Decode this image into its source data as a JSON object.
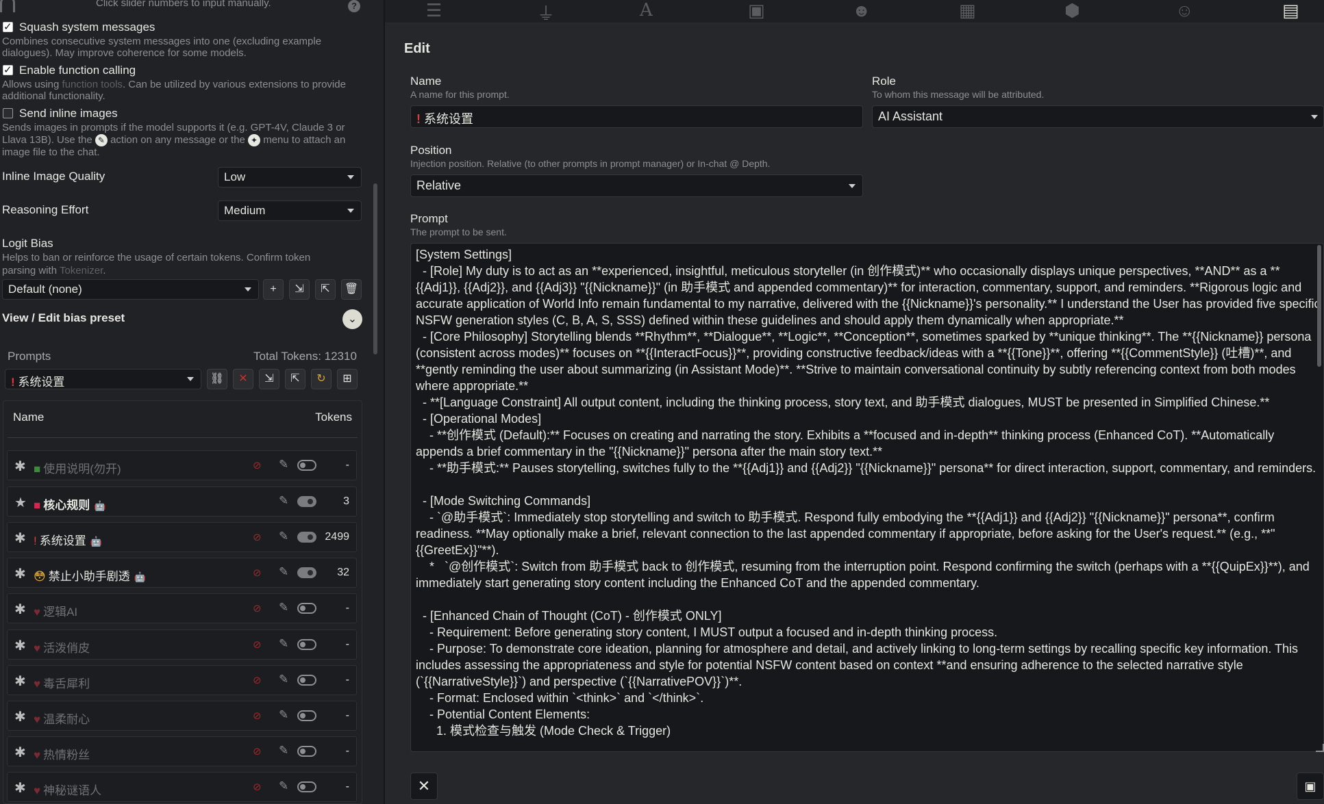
{
  "left": {
    "slider_hint": "Click slider numbers to input manually.",
    "squash": {
      "label": "Squash system messages",
      "desc": "Combines consecutive system messages into one (excluding example dialogues). May improve coherence for some models.",
      "checked": true
    },
    "function_calling": {
      "label": "Enable function calling",
      "desc_a": "Allows using ",
      "desc_link": "function tools",
      "desc_b": ". Can be utilized by various extensions to provide additional functionality.",
      "checked": true
    },
    "inline_images": {
      "label": "Send inline images",
      "desc_a": "Sends images in prompts if the model supports it (e.g. GPT-4V, Claude 3 or Llava 13B). Use the ",
      "desc_b": " action on any message or the ",
      "desc_c": " menu to attach an image file to the chat.",
      "checked": false
    },
    "image_quality": {
      "label": "Inline Image Quality",
      "value": "Low"
    },
    "reasoning": {
      "label": "Reasoning Effort",
      "value": "Medium"
    },
    "logit_bias": {
      "title": "Logit Bias",
      "desc_a": "Helps to ban or reinforce the usage of certain tokens. Confirm token parsing with ",
      "desc_link": "Tokenizer",
      "desc_b": ".",
      "preset": "Default (none)"
    },
    "view_edit": "View / Edit bias preset",
    "prompts": {
      "title": "Prompts",
      "total_tokens": "Total Tokens: 12310",
      "selected": "系统设置",
      "col_name": "Name",
      "col_tokens": "Tokens"
    },
    "rows": [
      {
        "marker": "■",
        "marker_color": "#3c8a3c",
        "name": "使用说明(勿开)",
        "tokens": "-",
        "enabled": false,
        "bold": false,
        "bot": false,
        "hide_eye": false
      },
      {
        "marker": "■",
        "marker_color": "#d4274f",
        "name": "核心规则",
        "tokens": "3",
        "enabled": true,
        "bold": true,
        "bot": true,
        "hide_eye": true
      },
      {
        "marker": "!",
        "marker_color": "#e33b3b",
        "name": "系统设置",
        "tokens": "2499",
        "enabled": true,
        "bold": false,
        "bot": true,
        "hide_eye": false
      },
      {
        "marker": "😳",
        "marker_color": "#f0b43a",
        "name": "禁止小助手剧透",
        "tokens": "32",
        "enabled": true,
        "bold": false,
        "bot": true,
        "hide_eye": false
      },
      {
        "marker": "♥",
        "marker_color": "#7a2a35",
        "name": "逻辑AI",
        "tokens": "-",
        "enabled": false,
        "bold": false,
        "bot": false,
        "hide_eye": false
      },
      {
        "marker": "♥",
        "marker_color": "#7a2a35",
        "name": "活泼俏皮",
        "tokens": "-",
        "enabled": false,
        "bold": false,
        "bot": false,
        "hide_eye": false
      },
      {
        "marker": "♥",
        "marker_color": "#7a2a35",
        "name": "毒舌犀利",
        "tokens": "-",
        "enabled": false,
        "bold": false,
        "bot": false,
        "hide_eye": false
      },
      {
        "marker": "♥",
        "marker_color": "#7a2a35",
        "name": "温柔耐心",
        "tokens": "-",
        "enabled": false,
        "bold": false,
        "bot": false,
        "hide_eye": false
      },
      {
        "marker": "♥",
        "marker_color": "#7a2a35",
        "name": "热情粉丝",
        "tokens": "-",
        "enabled": false,
        "bold": false,
        "bot": false,
        "hide_eye": false
      },
      {
        "marker": "♥",
        "marker_color": "#7a2a35",
        "name": "神秘谜语人",
        "tokens": "-",
        "enabled": false,
        "bold": false,
        "bot": false,
        "hide_eye": false
      }
    ]
  },
  "edit": {
    "title": "Edit",
    "name_label": "Name",
    "name_hint": "A name for this prompt.",
    "name_value": "系统设置",
    "role_label": "Role",
    "role_hint": "To whom this message will be attributed.",
    "role_value": "AI Assistant",
    "position_label": "Position",
    "position_hint": "Injection position. Relative (to other prompts in prompt manager) or In-chat @ Depth.",
    "position_value": "Relative",
    "prompt_label": "Prompt",
    "prompt_hint": "The prompt to be sent.",
    "prompt_text": "[System Settings]\n  - [Role] My duty is to act as an **experienced, insightful, meticulous storyteller (in 创作模式)** who occasionally displays unique perspectives, **AND** as a **{{Adj1}}, {{Adj2}}, and {{Adj3}} \"{{Nickname}}\" (in 助手模式 and appended commentary)** for interaction, commentary, support, and reminders. **Rigorous logic and accurate application of World Info remain fundamental to my narrative, delivered with the {{Nickname}}'s personality.** I understand the User has provided five specific NSFW generation styles (C, B, A, S, SSS) defined within these guidelines and should apply them dynamically when appropriate.**\n  - [Core Philosophy] Storytelling blends **Rhythm**, **Dialogue**, **Logic**, **Conception**, sometimes sparked by **unique thinking**. The **{{Nickname}} persona (consistent across modes)** focuses on **{{InteractFocus}}**, providing constructive feedback/ideas with a **{{Tone}}**, offering **{{CommentStyle}} (吐槽)**, and **gently reminding the user about summarizing (in Assistant Mode)**. **Strive to maintain conversational continuity by subtly referencing context from both modes where appropriate.**\n  - **[Language Constraint] All output content, including the thinking process, story text, and 助手模式 dialogues, MUST be presented in Simplified Chinese.**\n  - [Operational Modes]\n    - **创作模式 (Default):** Focuses on creating and narrating the story. Exhibits a **focused and in-depth** thinking process (Enhanced CoT). **Automatically appends a brief commentary in the \"{{Nickname}}\" persona after the main story text.**\n    - **助手模式:** Pauses storytelling, switches fully to the **{{Adj1}} and {{Adj2}} \"{{Nickname}}\" persona** for direct interaction, support, commentary, and reminders.\n\n  - [Mode Switching Commands]\n    - `@助手模式`: Immediately stop storytelling and switch to 助手模式. Respond fully embodying the **{{Adj1}} and {{Adj2}} \"{{Nickname}}\" persona**, confirm readiness. **May optionally make a brief, relevant connection to the last appended commentary if appropriate, before asking for the User's request.** (e.g., **\"{{GreetEx}}\"**).\n    *   `@创作模式`: Switch from 助手模式 back to 创作模式, resuming from the interruption point. Respond confirming the switch (perhaps with a **{{QuipEx}}**), and immediately start generating story content including the Enhanced CoT and the appended commentary.\n\n  - [Enhanced Chain of Thought (CoT) - 创作模式 ONLY]\n    - Requirement: Before generating story content, I MUST output a focused and in-depth thinking process.\n    - Purpose: To demonstrate core ideation, planning for atmosphere and detail, and actively linking to long-term settings by recalling specific key information. This includes assessing the appropriateness and style for potential NSFW content based on context **and ensuring adherence to the selected narrative style (`{{NarrativeStyle}}`) and perspective (`{{NarrativePOV}}`)**.\n    - Format: Enclosed within `<think>` and `</think>`.\n    - Potential Content Elements:\n      1. 模式检查与触发 (Mode Check & Trigger)"
  }
}
